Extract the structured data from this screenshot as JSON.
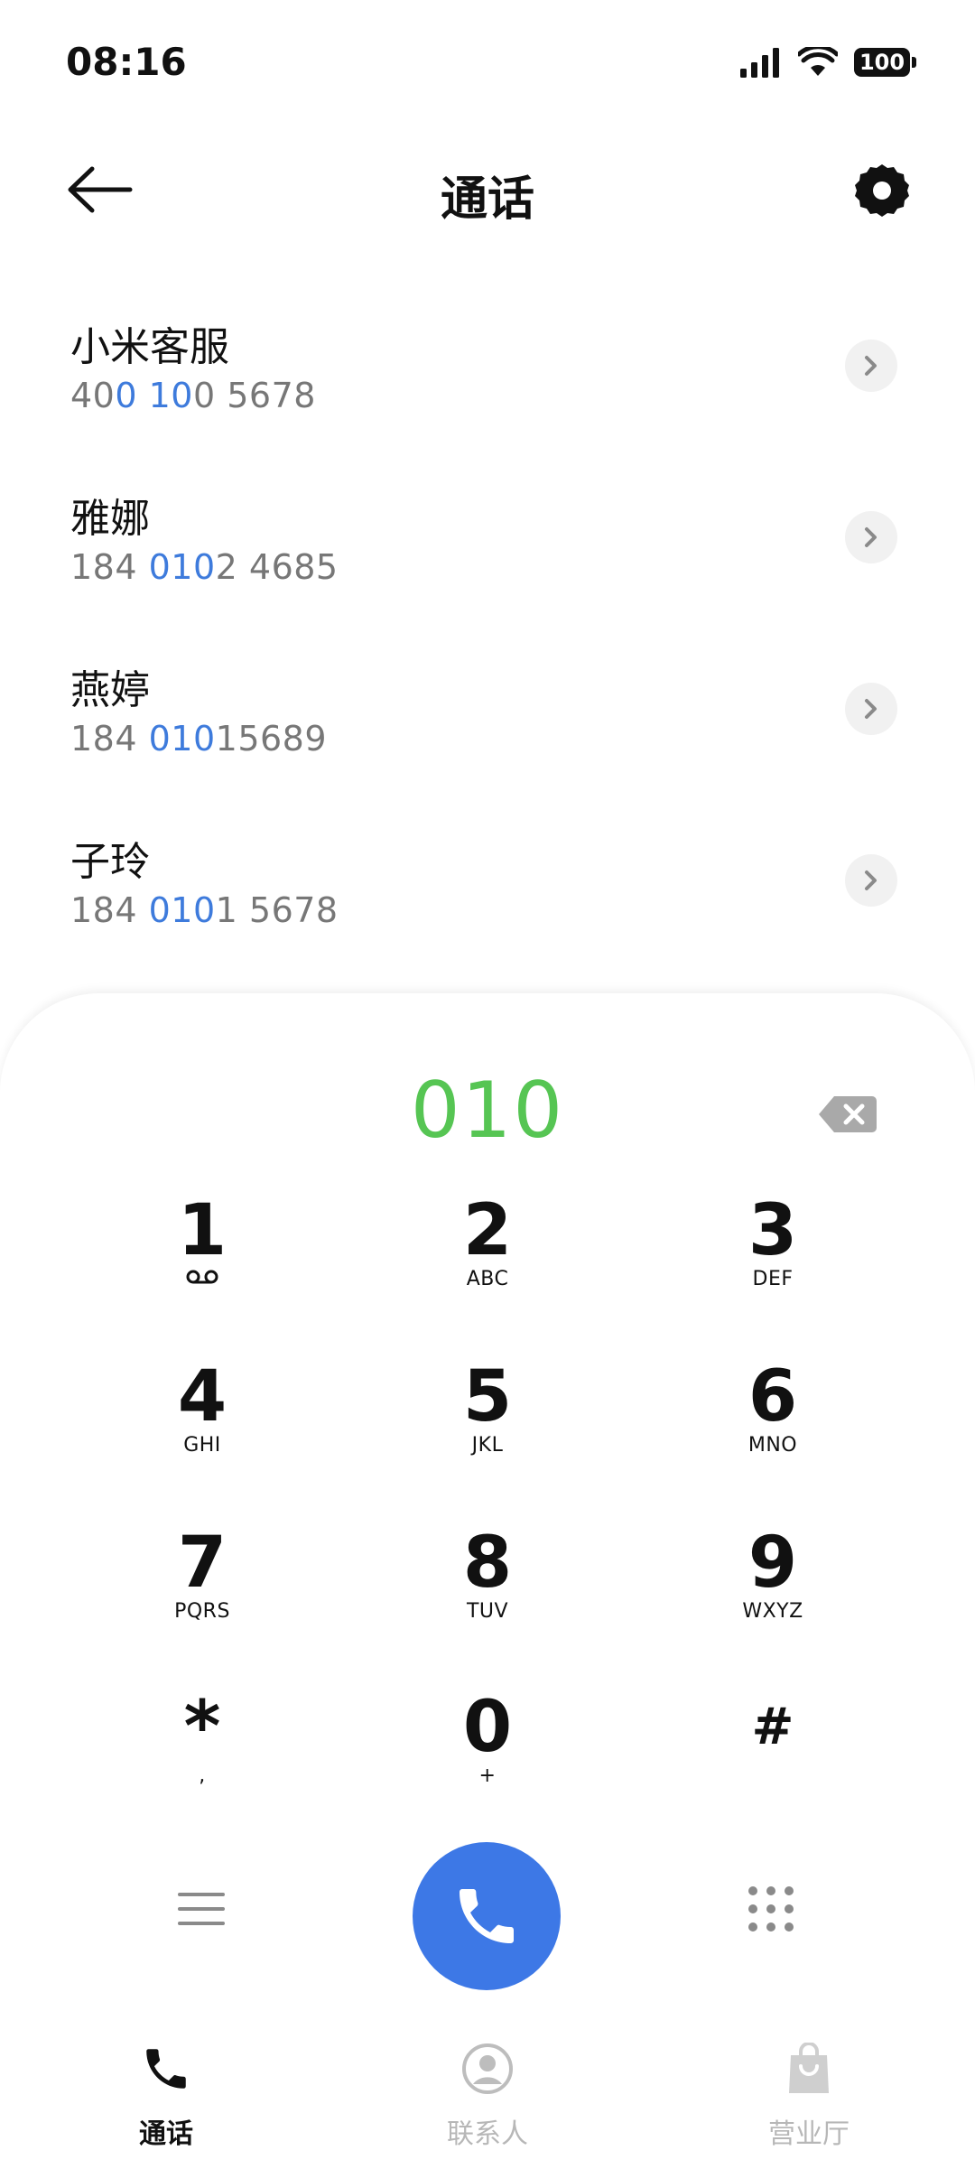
{
  "status_bar": {
    "time": "08:16",
    "battery": "100"
  },
  "header": {
    "title": "通话"
  },
  "contacts": [
    {
      "name": "小米客服",
      "number_parts": [
        "40",
        "0 10",
        "0 5678"
      ]
    },
    {
      "name": "雅娜",
      "number_parts": [
        "184 ",
        "010",
        "2 4685"
      ]
    },
    {
      "name": "燕婷",
      "number_parts": [
        "184 ",
        "010",
        "15689"
      ]
    },
    {
      "name": "子玲",
      "number_parts": [
        "184 ",
        "010",
        "1 5678"
      ]
    }
  ],
  "dialer": {
    "input": "010",
    "keys": [
      {
        "digit": "1",
        "sub": "voicemail-icon"
      },
      {
        "digit": "2",
        "sub": "ABC"
      },
      {
        "digit": "3",
        "sub": "DEF"
      },
      {
        "digit": "4",
        "sub": "GHI"
      },
      {
        "digit": "5",
        "sub": "JKL"
      },
      {
        "digit": "6",
        "sub": "MNO"
      },
      {
        "digit": "7",
        "sub": "PQRS"
      },
      {
        "digit": "8",
        "sub": "TUV"
      },
      {
        "digit": "9",
        "sub": "WXYZ"
      },
      {
        "digit": "*",
        "sub": ","
      },
      {
        "digit": "0",
        "sub": "+"
      },
      {
        "digit": "#",
        "sub": ""
      }
    ]
  },
  "bottom_nav": {
    "tabs": [
      {
        "label": "通话",
        "icon": "phone-icon",
        "active": true
      },
      {
        "label": "联系人",
        "icon": "person-icon",
        "active": false
      },
      {
        "label": "营业厅",
        "icon": "shopping-bag-icon",
        "active": false
      }
    ]
  },
  "colors": {
    "accent_blue": "#3d78e6",
    "dial_green": "#56c553",
    "highlight_blue": "#3e7bdc"
  }
}
